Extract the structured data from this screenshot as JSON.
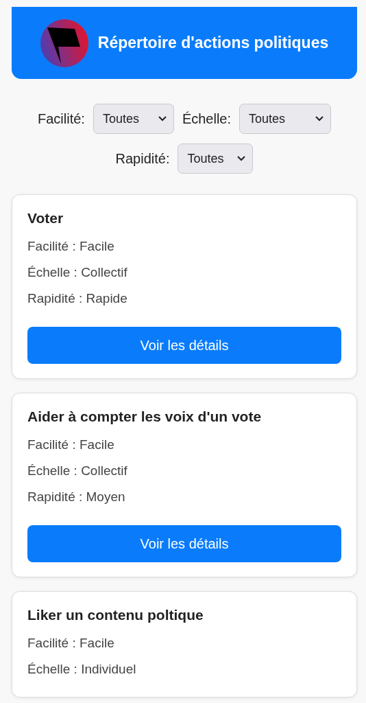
{
  "header": {
    "title": "Répertoire d'actions politiques"
  },
  "filters": [
    {
      "label": "Facilité:",
      "value": "Toutes"
    },
    {
      "label": "Échelle:",
      "value": "Toutes"
    },
    {
      "label": "Rapidité:",
      "value": "Toutes"
    }
  ],
  "actions": [
    {
      "title": "Voter",
      "details": [
        "Facilité : Facile",
        "Échelle : Collectif",
        "Rapidité : Rapide"
      ],
      "button": "Voir les détails"
    },
    {
      "title": "Aider à compter les voix d'un vote",
      "details": [
        "Facilité : Facile",
        "Échelle : Collectif",
        "Rapidité : Moyen"
      ],
      "button": "Voir les détails"
    },
    {
      "title": "Liker un contenu poltique",
      "details": [
        "Facilité : Facile",
        "Échelle : Individuel"
      ]
    }
  ]
}
